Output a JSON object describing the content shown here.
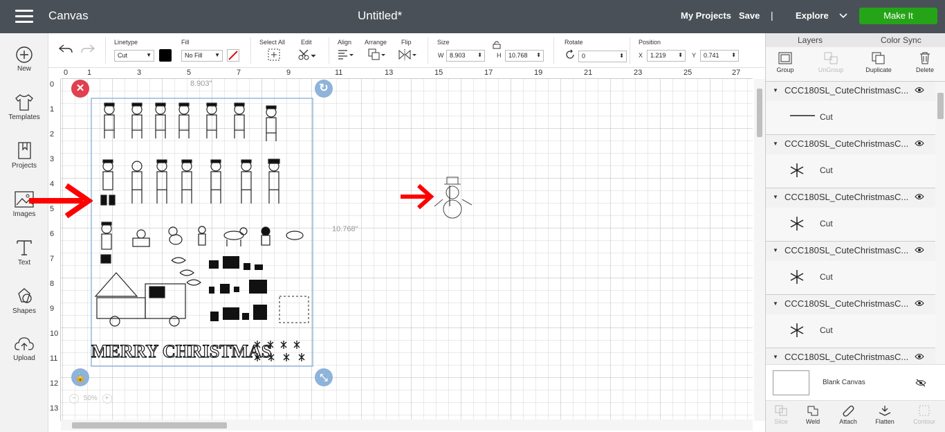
{
  "topbar": {
    "app_title": "Canvas",
    "doc_title": "Untitled*",
    "my_projects": "My Projects",
    "save": "Save",
    "separator": "|",
    "explore": "Explore",
    "make_it": "Make It"
  },
  "leftbar": {
    "items": [
      {
        "label": "New",
        "icon": "plus-circle-icon"
      },
      {
        "label": "Templates",
        "icon": "shirt-icon"
      },
      {
        "label": "Projects",
        "icon": "bookmark-book-icon"
      },
      {
        "label": "Images",
        "icon": "image-icon"
      },
      {
        "label": "Text",
        "icon": "text-t-icon"
      },
      {
        "label": "Shapes",
        "icon": "shapes-icon"
      },
      {
        "label": "Upload",
        "icon": "cloud-upload-icon"
      }
    ]
  },
  "toolbar": {
    "linetype_label": "Linetype",
    "linetype_value": "Cut",
    "fill_label": "Fill",
    "fill_value": "No Fill",
    "select_all_label": "Select All",
    "edit_label": "Edit",
    "align_label": "Align",
    "arrange_label": "Arrange",
    "flip_label": "Flip",
    "size_label": "Size",
    "w_label": "W",
    "w_value": "8.903",
    "h_label": "H",
    "h_value": "10.768",
    "rotate_label": "Rotate",
    "rotate_value": "0",
    "position_label": "Position",
    "x_label": "X",
    "x_value": "1.219",
    "y_label": "Y",
    "y_value": "0.741"
  },
  "canvas": {
    "ruler_top": [
      "0",
      "1",
      "3",
      "5",
      "7",
      "9",
      "11",
      "13",
      "15",
      "17",
      "19",
      "21",
      "23",
      "25",
      "27"
    ],
    "ruler_left": [
      "0",
      "1",
      "2",
      "3",
      "4",
      "5",
      "6",
      "7",
      "8",
      "9",
      "10",
      "11",
      "12",
      "13"
    ],
    "width_label": "8.903\"",
    "height_label": "10.768\"",
    "greeting_text": "MERRY CHRISTMAS",
    "zoom_value": "50%",
    "zoom_minus": "−",
    "zoom_plus": "+"
  },
  "rpanel": {
    "tab_layers": "Layers",
    "tab_color_sync": "Color Sync",
    "tools": [
      {
        "label": "Group",
        "enabled": true
      },
      {
        "label": "UnGroup",
        "enabled": false
      },
      {
        "label": "Duplicate",
        "enabled": true
      },
      {
        "label": "Delete",
        "enabled": true
      }
    ],
    "layers": [
      {
        "name": "CCC180SL_CuteChristmasC...",
        "child": "Cut"
      },
      {
        "name": "CCC180SL_CuteChristmasC...",
        "child": "Cut"
      },
      {
        "name": "CCC180SL_CuteChristmasC...",
        "child": "Cut"
      },
      {
        "name": "CCC180SL_CuteChristmasC...",
        "child": "Cut"
      },
      {
        "name": "CCC180SL_CuteChristmasC...",
        "child": "Cut"
      },
      {
        "name": "CCC180SL_CuteChristmasC...",
        "child": ""
      }
    ],
    "blank_canvas": "Blank Canvas",
    "bottom_tools": [
      {
        "label": "Slice",
        "enabled": false
      },
      {
        "label": "Weld",
        "enabled": true
      },
      {
        "label": "Attach",
        "enabled": true
      },
      {
        "label": "Flatten",
        "enabled": true
      },
      {
        "label": "Contour",
        "enabled": false
      }
    ]
  },
  "colors": {
    "topbar": "#4a5057",
    "make_it": "#25a418",
    "annotation_arrow": "#ff0000",
    "selection": "#8fb3d9",
    "delete_badge": "#e0404f"
  }
}
